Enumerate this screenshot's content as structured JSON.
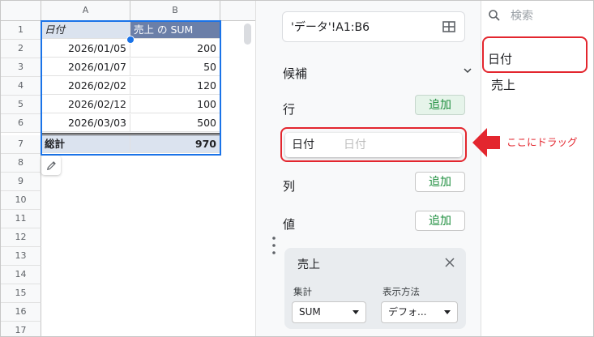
{
  "sheet": {
    "columns": [
      "A",
      "B"
    ],
    "rows": [
      "1",
      "2",
      "3",
      "4",
      "5",
      "6",
      "7",
      "8",
      "9",
      "10",
      "11",
      "12",
      "13",
      "14",
      "15",
      "16",
      "17"
    ],
    "header": [
      "日付",
      "売上 の SUM"
    ],
    "data": [
      [
        "2026/01/05",
        "200"
      ],
      [
        "2026/01/07",
        "50"
      ],
      [
        "2026/02/02",
        "120"
      ],
      [
        "2026/02/12",
        "100"
      ],
      [
        "2026/03/03",
        "500"
      ]
    ],
    "total": [
      "総計",
      "970"
    ],
    "selection_color": "#1a73e8"
  },
  "editor": {
    "range": "'データ'!A1:B6",
    "suggestions_label": "候補",
    "rows_label": "行",
    "columns_label": "列",
    "values_label": "値",
    "add_label": "追加",
    "dragging_item": "日付",
    "dragging_ghost": "日付",
    "value_card": {
      "title": "売上",
      "summarize_label": "集計",
      "summarize_value": "SUM",
      "display_label": "表示方法",
      "display_value": "デフォ..."
    }
  },
  "fields": {
    "search_placeholder": "検索",
    "items": [
      "日付",
      "売上"
    ]
  },
  "annotation": {
    "text": "ここにドラッグ",
    "color": "#e3262e"
  }
}
